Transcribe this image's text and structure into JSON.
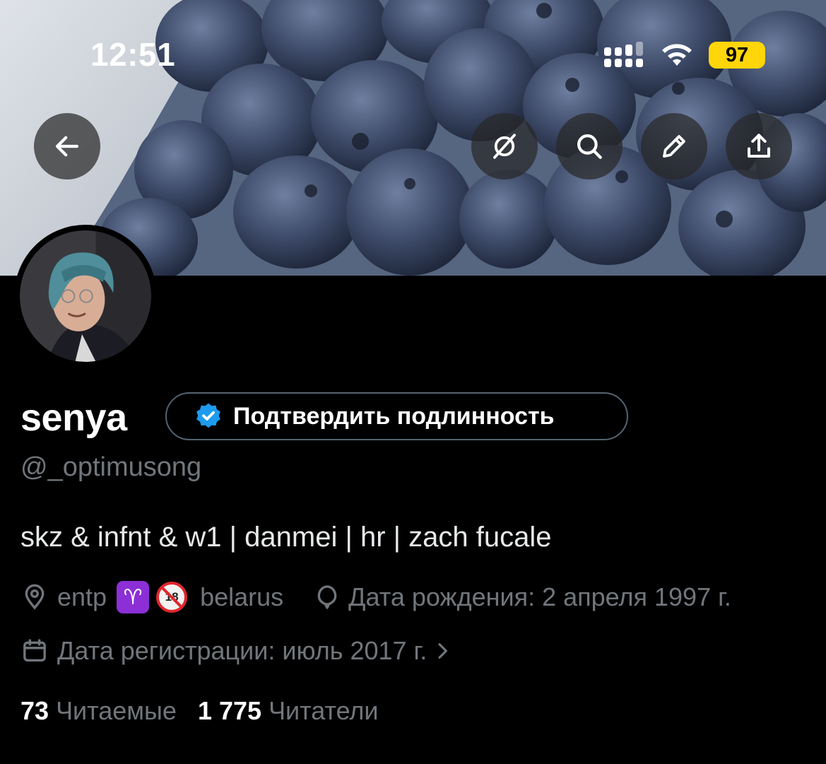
{
  "status_bar": {
    "time": "12:51",
    "battery": "97",
    "battery_color": "#ffd60a"
  },
  "header": {
    "back_icon": "arrow-left-icon",
    "actions": [
      "grok-icon",
      "search-icon",
      "pencil-icon",
      "share-icon"
    ]
  },
  "profile": {
    "name": "senya",
    "verify_button": "Подтвердить подлинность",
    "handle": "@_optimusong",
    "bio": "skz & infnt & w1 | danmei | hr | zach fucale",
    "location": "entp",
    "location_emoji_aries": "♈",
    "location_emoji_18": "18",
    "location_suffix": "belarus",
    "birthday": "Дата рождения: 2 апреля 1997 г.",
    "joined": "Дата регистрации: июль 2017 г.",
    "following_count": "73",
    "following_label": "Читаемые",
    "followers_count": "1 775",
    "followers_label": "Читатели"
  },
  "colors": {
    "background": "#000000",
    "verified_badge": "#1d9bf0",
    "muted_text": "#71767b",
    "aries_emoji": "#8c2fd6"
  }
}
